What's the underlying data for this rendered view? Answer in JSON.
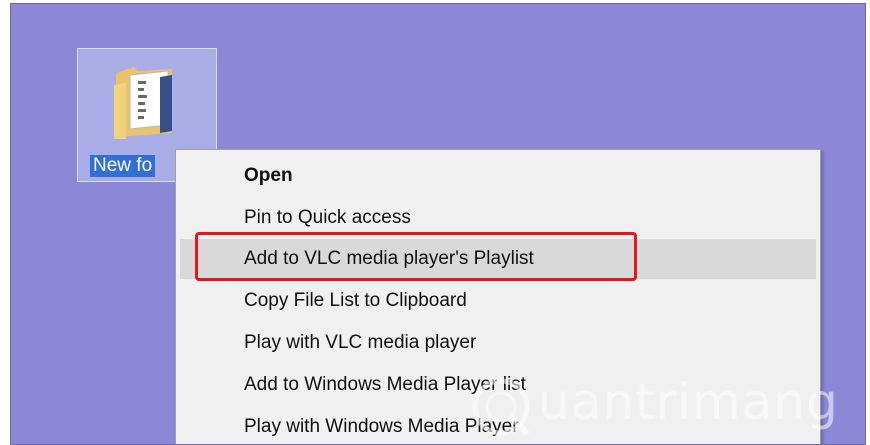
{
  "desktop": {
    "background_color": "#8d87d8",
    "folder": {
      "label": "New fo",
      "icon": "folder-icon"
    }
  },
  "context_menu": {
    "items": [
      {
        "label": "Open",
        "bold": true
      },
      {
        "label": "Pin to Quick access",
        "bold": false
      },
      {
        "label": "Add to VLC media player's Playlist",
        "bold": false,
        "hovered": true,
        "highlighted": true
      },
      {
        "label": "Copy File List to Clipboard",
        "bold": false
      },
      {
        "label": "Play with VLC media player",
        "bold": false
      },
      {
        "label": "Add to Windows Media Player list",
        "bold": false
      },
      {
        "label": "Play with Windows Media Player",
        "bold": false
      }
    ],
    "highlight_color": "#e8141c",
    "hover_color": "#d9d9d9"
  },
  "watermark": {
    "text": "uantrimang"
  }
}
